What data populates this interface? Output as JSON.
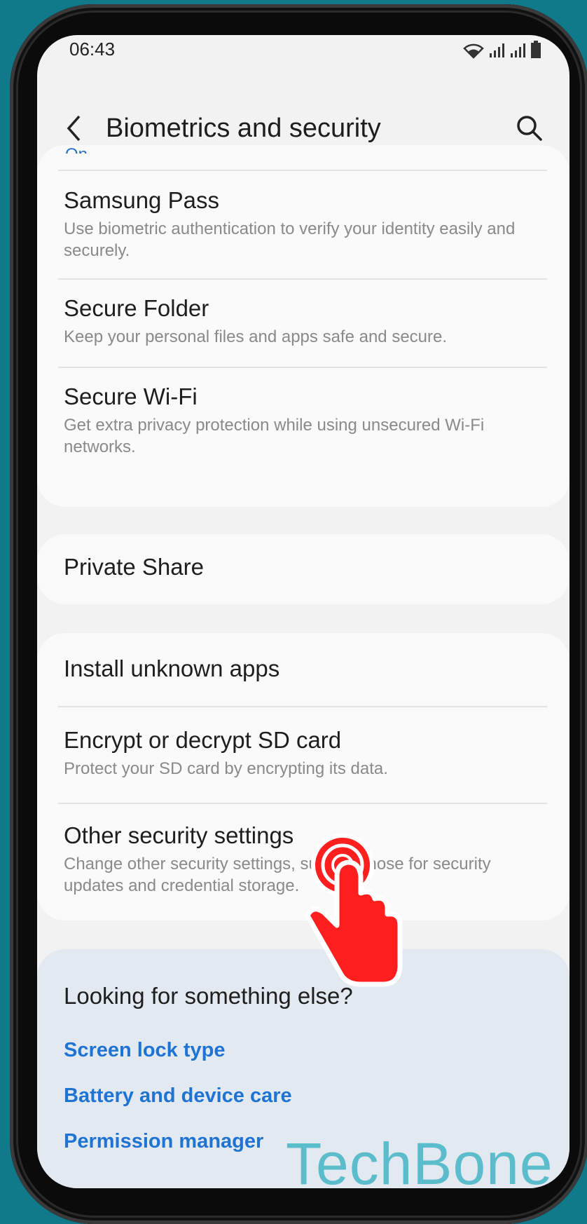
{
  "status_bar": {
    "time": "06:43"
  },
  "header": {
    "title": "Biometrics and security"
  },
  "top_card": {
    "partial_text": "On",
    "items": [
      {
        "title": "Samsung Pass",
        "subtitle": "Use biometric authentication to verify your identity easily and securely."
      },
      {
        "title": "Secure Folder",
        "subtitle": "Keep your personal files and apps safe and secure."
      },
      {
        "title": "Secure Wi-Fi",
        "subtitle": "Get extra privacy protection while using unsecured Wi-Fi networks."
      }
    ]
  },
  "private_card": {
    "title": "Private Share"
  },
  "install_card": {
    "items": [
      {
        "title": "Install unknown apps"
      },
      {
        "title": "Encrypt or decrypt SD card",
        "subtitle": "Protect your SD card by encrypting its data."
      },
      {
        "title": "Other security settings",
        "subtitle": "Change other security settings, such as those for security updates and credential storage."
      }
    ]
  },
  "suggestions": {
    "title": "Looking for something else?",
    "links": [
      "Screen lock type",
      "Battery and device care",
      "Permission manager"
    ]
  },
  "watermark": "TechBone",
  "colors": {
    "background": "#107a8b",
    "link": "#1f73d2",
    "tap_indicator": "#ff1f1f"
  }
}
